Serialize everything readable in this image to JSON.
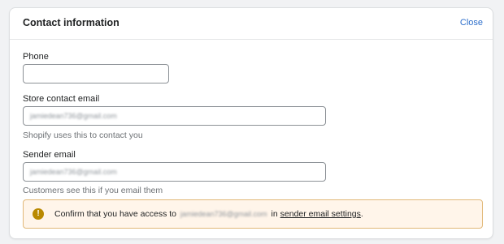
{
  "header": {
    "title": "Contact information",
    "close_label": "Close"
  },
  "phone": {
    "label": "Phone",
    "value": ""
  },
  "store_email": {
    "label": "Store contact email",
    "value": "jamiedean736@gmail.com",
    "help": "Shopify uses this to contact you"
  },
  "sender_email": {
    "label": "Sender email",
    "value": "jamiedean736@gmail.com",
    "help": "Customers see this if you email them"
  },
  "banner": {
    "icon": "warning-icon",
    "icon_glyph": "!",
    "text_before": "Confirm that you have access to",
    "email": "jamiedean736@gmail.com",
    "text_middle": "in",
    "link_label": "sender email settings",
    "text_after": ".",
    "accent_color": "#b98900"
  }
}
